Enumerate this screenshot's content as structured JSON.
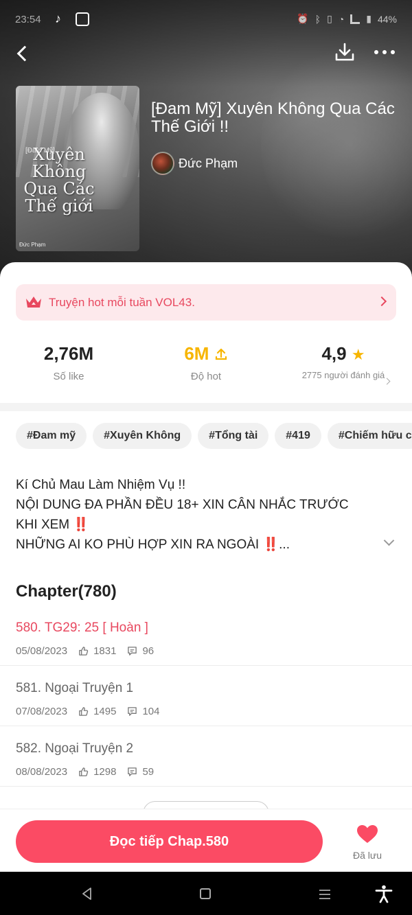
{
  "status_bar": {
    "time": "23:54",
    "battery": "44%"
  },
  "story": {
    "title": "[Đam Mỹ] Xuyên Không Qua Các Thế Giới !!",
    "author": "Đức Phạm",
    "cover": {
      "tag": "[Đam Mỹ]",
      "title": "Xuyên Không Qua Các Thế giới",
      "author": "Đức Phạm"
    }
  },
  "hot_banner": {
    "text": "Truyện hot mỗi tuần VOL43."
  },
  "stats": {
    "likes": {
      "value": "2,76M",
      "label": "Số like"
    },
    "hot": {
      "value": "6M",
      "label": "Độ hot"
    },
    "rating": {
      "value": "4,9",
      "label": "2775 người đánh giá"
    }
  },
  "tags": [
    "#Đam mỹ",
    "#Xuyên Không",
    "#Tổng tài",
    "#419",
    "#Chiếm hữu c"
  ],
  "description": {
    "line1": "Kí Chủ Mau Làm Nhiệm Vụ !!",
    "line2": "NỘI DUNG ĐA PHẦN ĐỀU 18+ XIN CÂN NHẮC TRƯỚC KHI XEM",
    "line3": "NHỮNG AI KO PHÙ HỢP XIN RA NGOÀI",
    "bang": "‼️",
    "ellipsis": "..."
  },
  "chapter_list": {
    "heading": "Chapter(780)",
    "items": [
      {
        "title": "580. TG29: 25 [ Hoàn ]",
        "date": "05/08/2023",
        "likes": "1831",
        "comments": "96"
      },
      {
        "title": "581. Ngoại Truyện 1",
        "date": "07/08/2023",
        "likes": "1495",
        "comments": "104"
      },
      {
        "title": "582. Ngoại Truyện 2",
        "date": "08/08/2023",
        "likes": "1298",
        "comments": "59"
      }
    ]
  },
  "bottom_bar": {
    "read_button": "Đọc tiếp Chap.580",
    "saved_label": "Đã lưu"
  },
  "colors": {
    "accent": "#fb4b64",
    "hot_value": "#f7b500",
    "banner_bg": "#fde9ec"
  }
}
